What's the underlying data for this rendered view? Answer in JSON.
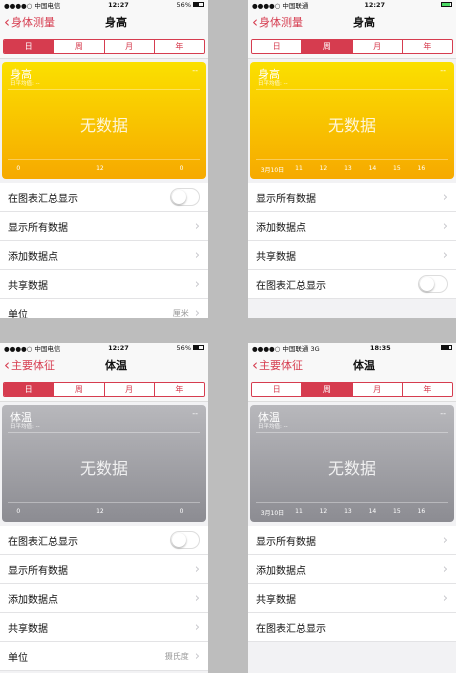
{
  "colors": {
    "accent": "#d63c4f",
    "chart_yellow": "#f6c400",
    "chart_gray": "#a4a4a8"
  },
  "panels": [
    {
      "status": {
        "carrier": "●●●●○ 中国电信",
        "time": "12:27",
        "battery": "56%"
      },
      "nav": {
        "back": "身体测量",
        "title": "身高"
      },
      "segments": [
        "日",
        "周",
        "月",
        "年"
      ],
      "active_segment": 0,
      "chart": {
        "title": "身高",
        "subtitle": "日平均值: --",
        "dash": "--",
        "nodata": "无数据",
        "ticks": [
          "0",
          "12",
          "0"
        ]
      },
      "rows": [
        {
          "label": "在图表汇总显示",
          "toggle": true
        },
        {
          "label": "显示所有数据"
        },
        {
          "label": "添加数据点"
        },
        {
          "label": "共享数据"
        },
        {
          "label": "单位",
          "value": "厘米"
        }
      ]
    },
    {
      "status": {
        "carrier": "●●●●○ 中国联通",
        "time": "12:27",
        "battery": ""
      },
      "nav": {
        "back": "身体测量",
        "title": "身高"
      },
      "segments": [
        "日",
        "周",
        "月",
        "年"
      ],
      "active_segment": 1,
      "chart": {
        "title": "身高",
        "subtitle": "日平均值: --",
        "dash": "--",
        "nodata": "无数据",
        "ticks": [
          "3月10日",
          "11",
          "12",
          "13",
          "14",
          "15",
          "16"
        ]
      },
      "rows": [
        {
          "label": "显示所有数据"
        },
        {
          "label": "添加数据点"
        },
        {
          "label": "共享数据"
        },
        {
          "label": "在图表汇总显示",
          "toggle": true
        }
      ]
    },
    {
      "status": {
        "carrier": "●●●●○ 中国电信",
        "time": "12:27",
        "battery": "56%"
      },
      "nav": {
        "back": "主要体征",
        "title": "体温"
      },
      "segments": [
        "日",
        "周",
        "月",
        "年"
      ],
      "active_segment": 0,
      "chart": {
        "title": "体温",
        "subtitle": "日平均值: --",
        "dash": "--",
        "nodata": "无数据",
        "ticks": [
          "0",
          "12",
          "0"
        ]
      },
      "rows": [
        {
          "label": "在图表汇总显示",
          "toggle": true
        },
        {
          "label": "显示所有数据"
        },
        {
          "label": "添加数据点"
        },
        {
          "label": "共享数据"
        },
        {
          "label": "单位",
          "value": "摄氏度"
        }
      ]
    },
    {
      "status": {
        "carrier": "●●●●○ 中国联通 3G",
        "time": "18:35",
        "battery": ""
      },
      "nav": {
        "back": "主要体征",
        "title": "体温"
      },
      "segments": [
        "日",
        "周",
        "月",
        "年"
      ],
      "active_segment": 1,
      "chart": {
        "title": "体温",
        "subtitle": "日平均值: --",
        "dash": "--",
        "nodata": "无数据",
        "ticks": [
          "3月10日",
          "11",
          "12",
          "13",
          "14",
          "15",
          "16"
        ]
      },
      "rows": [
        {
          "label": "显示所有数据"
        },
        {
          "label": "添加数据点"
        },
        {
          "label": "共享数据"
        },
        {
          "label": "在图表汇总显示"
        }
      ]
    }
  ]
}
